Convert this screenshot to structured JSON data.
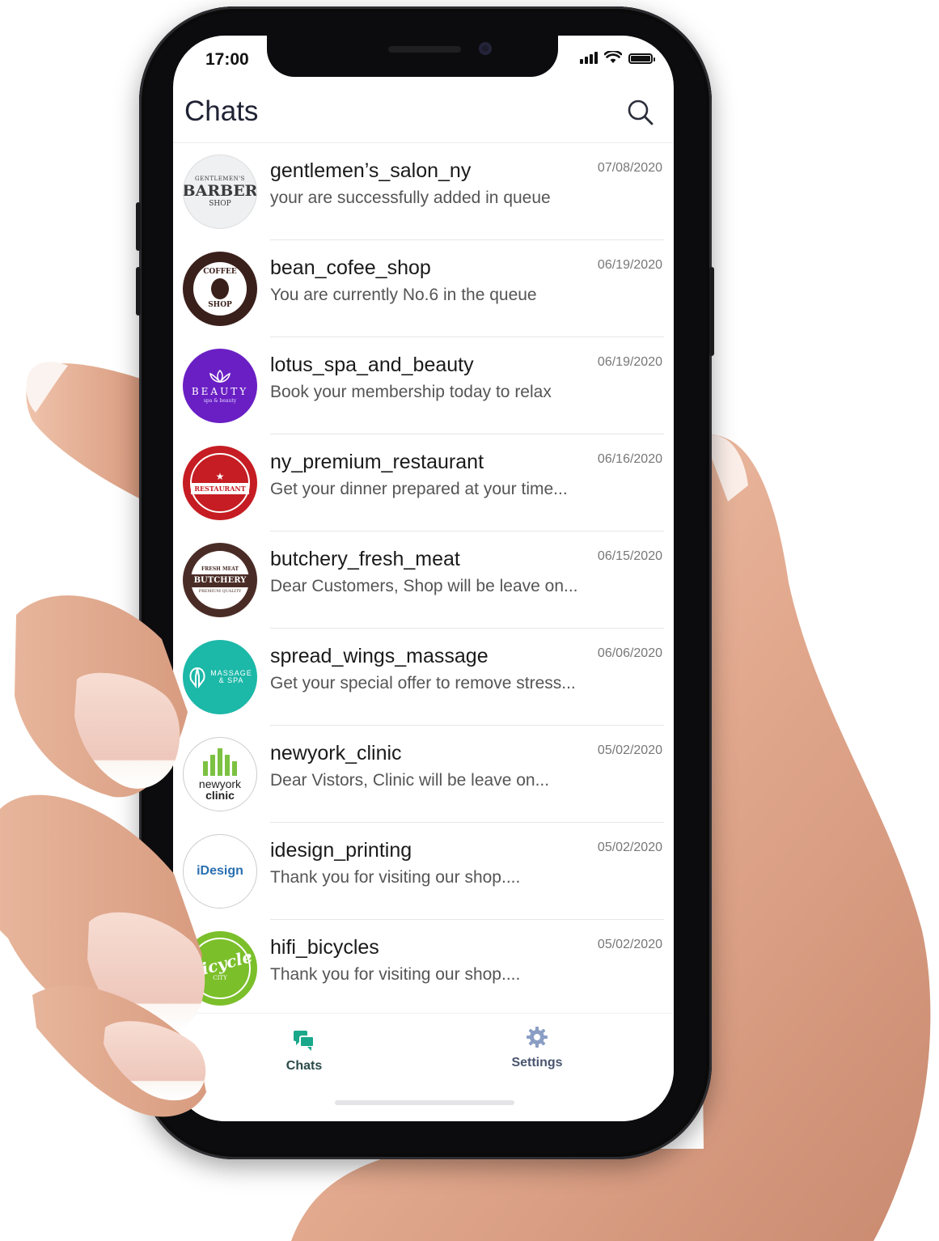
{
  "status_bar": {
    "time": "17:00"
  },
  "header": {
    "title": "Chats"
  },
  "chats": [
    {
      "name": "gentlemen’s_salon_ny",
      "date": "07/08/2020",
      "message": "your are successfully added in queue",
      "avatar": {
        "lines": [
          "GENTLEMEN'S",
          "BARBER",
          "SHOP"
        ],
        "color": "#eef0f1",
        "text_color": "#3b3b3b"
      }
    },
    {
      "name": "bean_cofee_shop",
      "date": "06/19/2020",
      "message": "You are currently No.6 in the queue",
      "avatar": {
        "lines": [
          "COFFEE",
          "SHOP"
        ],
        "color": "#3a201b",
        "text_color": "#ffffff"
      }
    },
    {
      "name": "lotus_spa_and_beauty",
      "date": "06/19/2020",
      "message": "Book your membership today to relax",
      "avatar": {
        "lines": [
          "BEAUTY",
          "spa & beauty"
        ],
        "color": "#6a1fc4",
        "text_color": "#ffffff"
      }
    },
    {
      "name": "ny_premium_restaurant",
      "date": "06/16/2020",
      "message": "Get your dinner prepared at your time...",
      "avatar": {
        "lines": [
          "RESTAURANT"
        ],
        "color": "#c51d23",
        "text_color": "#ffffff"
      }
    },
    {
      "name": "butchery_fresh_meat",
      "date": "06/15/2020",
      "message": "Dear Customers, Shop will be leave on...",
      "avatar": {
        "lines": [
          "FRESH MEAT",
          "BUTCHERY",
          "PREMIUM QUALITY"
        ],
        "color": "#4a2c26",
        "text_color": "#ffffff"
      }
    },
    {
      "name": "spread_wings_massage",
      "date": "06/06/2020",
      "message": "Get your special offer to remove stress...",
      "avatar": {
        "lines": [
          "MASSAGE",
          "& SPA"
        ],
        "color": "#1cb8a8",
        "text_color": "#ffffff"
      }
    },
    {
      "name": "newyork_clinic",
      "date": "05/02/2020",
      "message": "Dear Vistors, Clinic will be leave on...",
      "avatar": {
        "lines": [
          "newyork",
          "clinic"
        ],
        "color": "#ffffff",
        "text_color": "#222222"
      }
    },
    {
      "name": "idesign_printing",
      "date": "05/02/2020",
      "message": "Thank you for visiting our shop....",
      "avatar": {
        "lines": [
          "iDesign"
        ],
        "color": "#ffffff",
        "text_color": "#2a6fb0"
      }
    },
    {
      "name": "hifi_bicycles",
      "date": "05/02/2020",
      "message": "Thank you for visiting our shop....",
      "avatar": {
        "lines": [
          "Bicycle",
          "CITY"
        ],
        "color": "#7bbf2a",
        "text_color": "#ffffff"
      }
    }
  ],
  "tabbar": {
    "chats": {
      "label": "Chats",
      "color": "#1aa88a",
      "icon": "chat-bubbles-icon"
    },
    "settings": {
      "label": "Settings",
      "color": "#4a5570",
      "icon": "gear-icon",
      "icon_color": "#8b9ec4"
    }
  }
}
